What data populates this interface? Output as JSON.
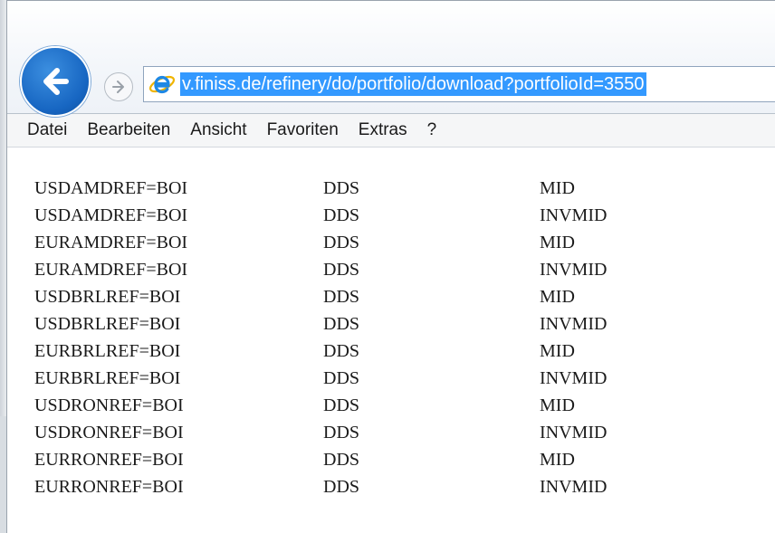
{
  "address_bar": {
    "url": "v.finiss.de/refinery/do/portfolio/download?portfolioId=3550"
  },
  "icons": {
    "back": "back-arrow-icon",
    "forward": "forward-arrow-icon",
    "site": "internet-explorer-icon"
  },
  "colors": {
    "url_selection": "#3399ff",
    "back_button": "#1766c2"
  },
  "menu": {
    "items": [
      "Datei",
      "Bearbeiten",
      "Ansicht",
      "Favoriten",
      "Extras",
      "?"
    ]
  },
  "content": {
    "rows": [
      [
        "USDAMDREF=BOI",
        "DDS",
        "MID"
      ],
      [
        "USDAMDREF=BOI",
        "DDS",
        "INVMID"
      ],
      [
        "EURAMDREF=BOI",
        "DDS",
        "MID"
      ],
      [
        "EURAMDREF=BOI",
        "DDS",
        "INVMID"
      ],
      [
        "USDBRLREF=BOI",
        "DDS",
        "MID"
      ],
      [
        "USDBRLREF=BOI",
        "DDS",
        "INVMID"
      ],
      [
        "EURBRLREF=BOI",
        "DDS",
        "MID"
      ],
      [
        "EURBRLREF=BOI",
        "DDS",
        "INVMID"
      ],
      [
        "USDRONREF=BOI",
        "DDS",
        "MID"
      ],
      [
        "USDRONREF=BOI",
        "DDS",
        "INVMID"
      ],
      [
        "EURRONREF=BOI",
        "DDS",
        "MID"
      ],
      [
        "EURRONREF=BOI",
        "DDS",
        "INVMID"
      ]
    ]
  }
}
